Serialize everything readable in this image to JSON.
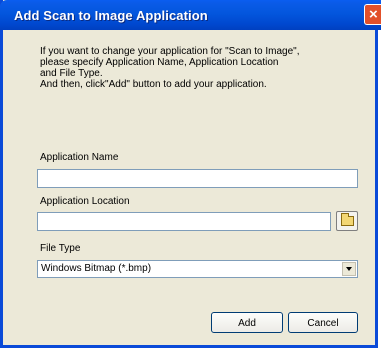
{
  "dialog": {
    "title": "Add Scan to Image Application",
    "close_label": "×"
  },
  "intro_text": "If you want to change your application for \"Scan to Image\",\nplease specify Application Name, Application Location\nand File Type.\nAnd then, click\"Add\" button to add your application.",
  "fields": {
    "app_name_label": "Application Name",
    "app_name_value": "",
    "app_location_label": "Application Location",
    "app_location_value": "",
    "file_type_label": "File Type",
    "file_type_selected": "Windows Bitmap (*.bmp)"
  },
  "buttons": {
    "add": "Add",
    "cancel": "Cancel"
  },
  "icons": [
    "close-icon",
    "folder-icon",
    "chevron-down-icon"
  ],
  "colors": {
    "titlebar": "#0356dd",
    "window_bg": "#ece9d8",
    "close": "#e2502a"
  }
}
